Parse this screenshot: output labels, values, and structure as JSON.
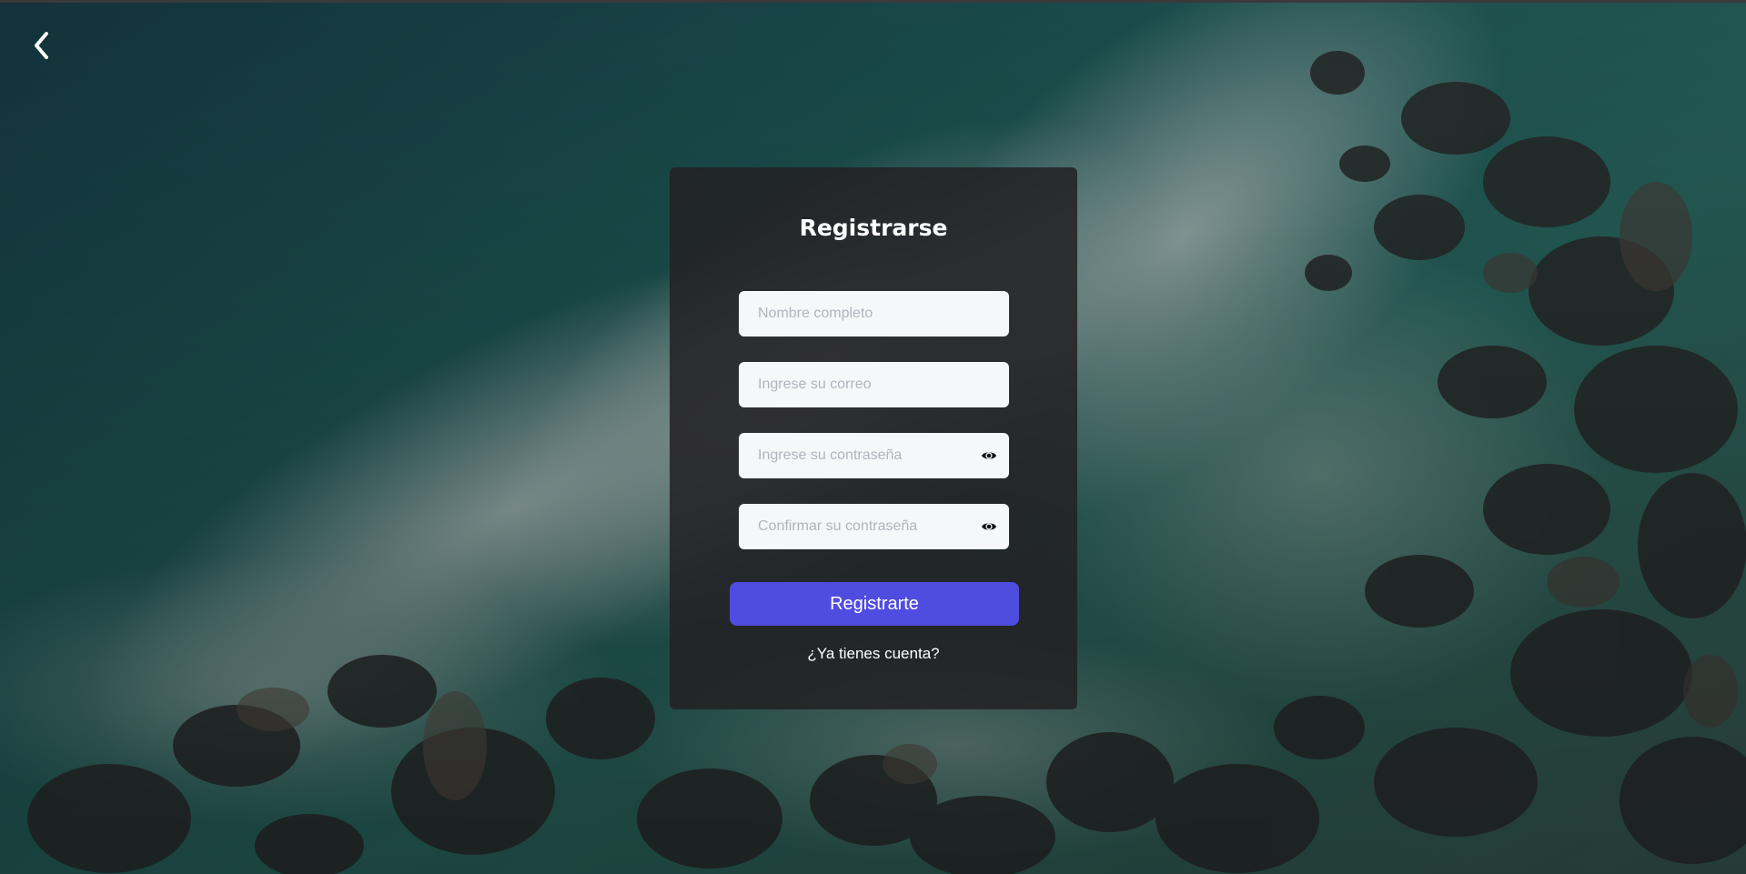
{
  "navigation": {
    "back_icon": "chevron-left-icon"
  },
  "register_form": {
    "title": "Registrarse",
    "fields": [
      {
        "placeholder": "Nombre completo",
        "value": ""
      },
      {
        "placeholder": "Ingrese su correo",
        "value": ""
      },
      {
        "placeholder": "Ingrese su contraseña",
        "value": "",
        "toggle_icon": "eye-icon"
      },
      {
        "placeholder": "Confirmar su contraseña",
        "value": "",
        "toggle_icon": "eye-icon"
      }
    ],
    "submit_label": "Registrarte",
    "login_link": "¿Ya tienes cuenta?"
  },
  "colors": {
    "primary_button": "#4f4ce0",
    "card_background": "#232124",
    "input_background": "#f6f7f9",
    "placeholder_text": "#b0b4bb"
  }
}
